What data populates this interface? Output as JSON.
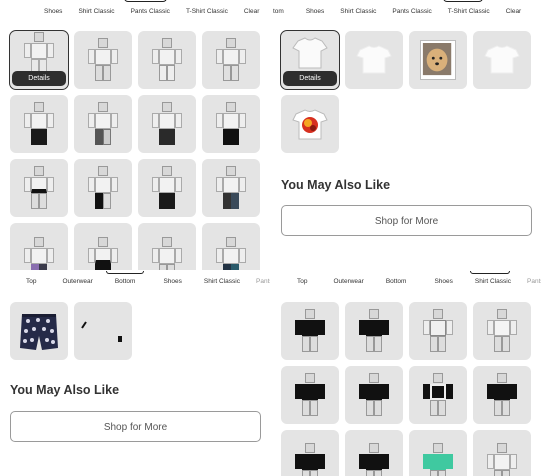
{
  "top_left": {
    "tabs": [
      "Shoes",
      "Shirt Classic",
      "Pants Classic",
      "T-Shirt Classic",
      "Clear"
    ],
    "selected_tab": "Pants Classic",
    "details_label": "Details"
  },
  "top_right": {
    "tabs": [
      "tom",
      "Shoes",
      "Shirt Classic",
      "Pants Classic",
      "T-Shirt Classic",
      "Clear"
    ],
    "selected_tab": "T-Shirt Classic",
    "details_label": "Details",
    "section_title": "You May Also Like",
    "shop_button": "Shop for More"
  },
  "bottom_left": {
    "tabs": [
      "Top",
      "Outerwear",
      "Bottom",
      "Shoes",
      "Shirt Classic",
      "Pants C"
    ],
    "selected_tab": "Bottom",
    "section_title": "You May Also Like",
    "shop_button": "Shop for More"
  },
  "bottom_right": {
    "tabs": [
      "Top",
      "Outerwear",
      "Bottom",
      "Shoes",
      "Shirt Classic",
      "Pants C"
    ],
    "selected_tab": "Shirt Classic"
  },
  "colors": {
    "cell_bg": "#e4e4e4",
    "details_bg": "#2e2e2e",
    "accent_teal": "#3fc9a0"
  }
}
